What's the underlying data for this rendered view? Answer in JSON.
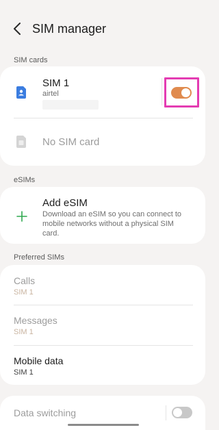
{
  "header": {
    "title": "SIM manager",
    "back_icon": "back-arrow-icon"
  },
  "sections": {
    "sim_cards": "SIM cards",
    "esims": "eSIMs",
    "preferred": "Preferred SIMs"
  },
  "sim_cards": {
    "sim1": {
      "title": "SIM 1",
      "carrier": "airtel",
      "enabled": true,
      "icon": "sim-card-icon"
    },
    "no_sim": {
      "title": "No SIM card",
      "icon": "sim-card-icon"
    }
  },
  "esim": {
    "title": "Add eSIM",
    "description": "Download an eSIM so you can connect to mobile networks without a physical SIM card.",
    "icon": "plus-icon"
  },
  "preferred": {
    "calls": {
      "title": "Calls",
      "value": "SIM 1"
    },
    "messages": {
      "title": "Messages",
      "value": "SIM 1"
    },
    "mobile_data": {
      "title": "Mobile data",
      "value": "SIM 1"
    }
  },
  "data_switching": {
    "title": "Data switching",
    "enabled": false
  },
  "colors": {
    "accent_toggle": "#e08b4f",
    "highlight": "#e43cb2",
    "sim_icon": "#3b7de0",
    "plus_icon": "#2fa84f",
    "toggle_off": "#c8c8c8"
  }
}
